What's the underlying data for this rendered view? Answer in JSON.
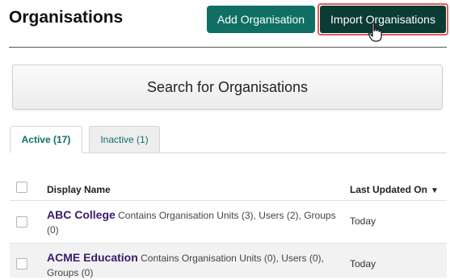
{
  "header": {
    "title": "Organisations"
  },
  "actions": {
    "add_label": "Add Organisation",
    "import_label": "Import Organisations"
  },
  "search": {
    "label": "Search for Organisations"
  },
  "tabs": [
    {
      "label": "Active (17)",
      "active": true
    },
    {
      "label": "Inactive (1)",
      "active": false
    }
  ],
  "table": {
    "headers": {
      "display_name": "Display Name",
      "last_updated": "Last Updated On",
      "sort_indicator": "▼"
    },
    "rows": [
      {
        "name": "ABC College",
        "details": "Contains Organisation Units (3), Users (2), Groups (0)",
        "updated": "Today"
      },
      {
        "name": "ACME Education",
        "details": "Contains Organisation Units (0), Users (0), Groups (0)",
        "updated": "Today"
      }
    ]
  },
  "colors": {
    "primary": "#0f6f64",
    "primary_dark": "#0b3b35",
    "highlight_border": "#e25a57",
    "link_purple": "#3a1a6b"
  },
  "icons": {
    "cursor": "hand-pointer-icon"
  }
}
